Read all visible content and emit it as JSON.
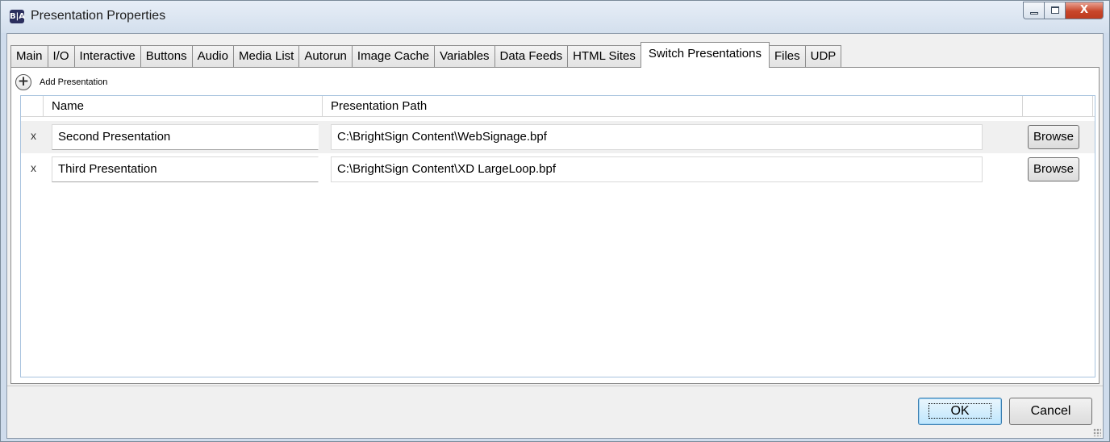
{
  "window": {
    "title": "Presentation Properties",
    "icon_text": "B|A",
    "close_glyph": "X"
  },
  "tabs": [
    {
      "label": "Main"
    },
    {
      "label": "I/O"
    },
    {
      "label": "Interactive"
    },
    {
      "label": "Buttons"
    },
    {
      "label": "Audio"
    },
    {
      "label": "Media List"
    },
    {
      "label": "Autorun"
    },
    {
      "label": "Image Cache"
    },
    {
      "label": "Variables"
    },
    {
      "label": "Data Feeds"
    },
    {
      "label": "HTML Sites"
    },
    {
      "label": "Switch Presentations",
      "active": true
    },
    {
      "label": "Files"
    },
    {
      "label": "UDP"
    }
  ],
  "toolbar": {
    "add_label": "Add Presentation",
    "add_glyph": "+"
  },
  "grid": {
    "columns": [
      "Name",
      "Presentation Path"
    ],
    "rows": [
      {
        "delete": "x",
        "name": "Second Presentation",
        "path": "C:\\BrightSign Content\\WebSignage.bpf",
        "browse": "Browse"
      },
      {
        "delete": "x",
        "name": "Third Presentation",
        "path": "C:\\BrightSign Content\\XD LargeLoop.bpf",
        "browse": "Browse"
      }
    ]
  },
  "footer": {
    "ok_label": "OK",
    "cancel_label": "Cancel"
  },
  "colors": {
    "title_bar": "#d9e4f1",
    "close_button": "#c8462a",
    "ok_focus": "#3c7fb1"
  }
}
